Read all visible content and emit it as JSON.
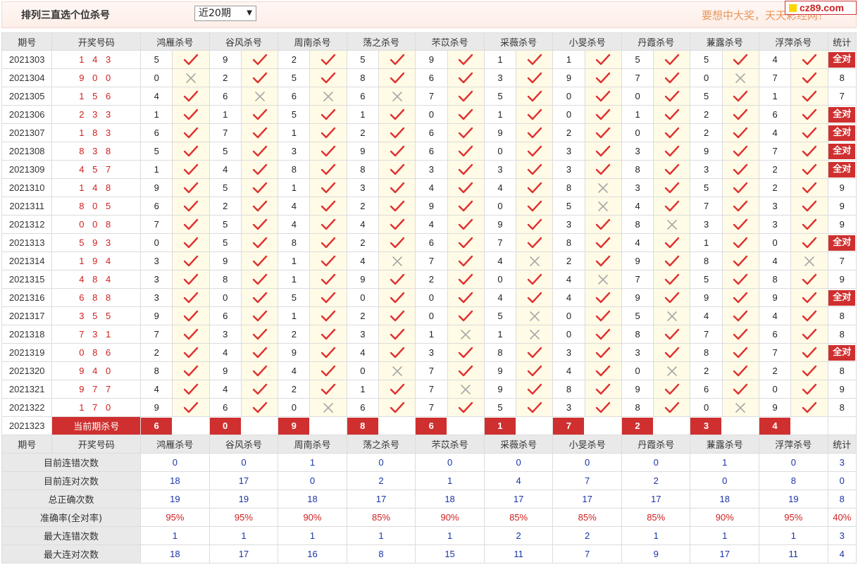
{
  "header": {
    "title": "排列三直选个位杀号",
    "period_select": "近20期",
    "slogan": "要想中大奖，天天彩经网！",
    "site": "cz89.com"
  },
  "columns": {
    "issue": "期号",
    "draw": "开奖号码",
    "experts": [
      "鸿雁杀号",
      "谷风杀号",
      "周南杀号",
      "荡之杀号",
      "芣苡杀号",
      "采薇杀号",
      "小旻杀号",
      "丹霞杀号",
      "蒹露杀号",
      "浮萍杀号"
    ],
    "stat": "统计"
  },
  "rows": [
    {
      "issue": "2021303",
      "draw": "1 4 3",
      "kills": [
        [
          5,
          1
        ],
        [
          9,
          1
        ],
        [
          2,
          1
        ],
        [
          5,
          1
        ],
        [
          9,
          1
        ],
        [
          1,
          1
        ],
        [
          1,
          1
        ],
        [
          5,
          1
        ],
        [
          5,
          1
        ],
        [
          4,
          1
        ]
      ],
      "stat": "全对"
    },
    {
      "issue": "2021304",
      "draw": "9 0 0",
      "kills": [
        [
          0,
          0
        ],
        [
          2,
          1
        ],
        [
          5,
          1
        ],
        [
          8,
          1
        ],
        [
          6,
          1
        ],
        [
          3,
          1
        ],
        [
          9,
          1
        ],
        [
          7,
          1
        ],
        [
          0,
          0
        ],
        [
          7,
          1
        ]
      ],
      "stat": "8"
    },
    {
      "issue": "2021305",
      "draw": "1 5 6",
      "kills": [
        [
          4,
          1
        ],
        [
          6,
          0
        ],
        [
          6,
          0
        ],
        [
          6,
          0
        ],
        [
          7,
          1
        ],
        [
          5,
          1
        ],
        [
          0,
          1
        ],
        [
          0,
          1
        ],
        [
          5,
          1
        ],
        [
          1,
          1
        ]
      ],
      "stat": "7"
    },
    {
      "issue": "2021306",
      "draw": "2 3 3",
      "kills": [
        [
          1,
          1
        ],
        [
          1,
          1
        ],
        [
          5,
          1
        ],
        [
          1,
          1
        ],
        [
          0,
          1
        ],
        [
          1,
          1
        ],
        [
          0,
          1
        ],
        [
          1,
          1
        ],
        [
          2,
          1
        ],
        [
          6,
          1
        ]
      ],
      "stat": "全对"
    },
    {
      "issue": "2021307",
      "draw": "1 8 3",
      "kills": [
        [
          6,
          1
        ],
        [
          7,
          1
        ],
        [
          1,
          1
        ],
        [
          2,
          1
        ],
        [
          6,
          1
        ],
        [
          9,
          1
        ],
        [
          2,
          1
        ],
        [
          0,
          1
        ],
        [
          2,
          1
        ],
        [
          4,
          1
        ]
      ],
      "stat": "全对"
    },
    {
      "issue": "2021308",
      "draw": "8 3 8",
      "kills": [
        [
          5,
          1
        ],
        [
          5,
          1
        ],
        [
          3,
          1
        ],
        [
          9,
          1
        ],
        [
          6,
          1
        ],
        [
          0,
          1
        ],
        [
          3,
          1
        ],
        [
          3,
          1
        ],
        [
          9,
          1
        ],
        [
          7,
          1
        ]
      ],
      "stat": "全对"
    },
    {
      "issue": "2021309",
      "draw": "4 5 7",
      "kills": [
        [
          1,
          1
        ],
        [
          4,
          1
        ],
        [
          8,
          1
        ],
        [
          8,
          1
        ],
        [
          3,
          1
        ],
        [
          3,
          1
        ],
        [
          3,
          1
        ],
        [
          8,
          1
        ],
        [
          3,
          1
        ],
        [
          2,
          1
        ]
      ],
      "stat": "全对"
    },
    {
      "issue": "2021310",
      "draw": "1 4 8",
      "kills": [
        [
          9,
          1
        ],
        [
          5,
          1
        ],
        [
          1,
          1
        ],
        [
          3,
          1
        ],
        [
          4,
          1
        ],
        [
          4,
          1
        ],
        [
          8,
          0
        ],
        [
          3,
          1
        ],
        [
          5,
          1
        ],
        [
          2,
          1
        ]
      ],
      "stat": "9"
    },
    {
      "issue": "2021311",
      "draw": "8 0 5",
      "kills": [
        [
          6,
          1
        ],
        [
          2,
          1
        ],
        [
          4,
          1
        ],
        [
          2,
          1
        ],
        [
          9,
          1
        ],
        [
          0,
          1
        ],
        [
          5,
          0
        ],
        [
          4,
          1
        ],
        [
          7,
          1
        ],
        [
          3,
          1
        ]
      ],
      "stat": "9"
    },
    {
      "issue": "2021312",
      "draw": "0 0 8",
      "kills": [
        [
          7,
          1
        ],
        [
          5,
          1
        ],
        [
          4,
          1
        ],
        [
          4,
          1
        ],
        [
          4,
          1
        ],
        [
          9,
          1
        ],
        [
          3,
          1
        ],
        [
          8,
          0
        ],
        [
          3,
          1
        ],
        [
          3,
          1
        ]
      ],
      "stat": "9"
    },
    {
      "issue": "2021313",
      "draw": "5 9 3",
      "kills": [
        [
          0,
          1
        ],
        [
          5,
          1
        ],
        [
          8,
          1
        ],
        [
          2,
          1
        ],
        [
          6,
          1
        ],
        [
          7,
          1
        ],
        [
          8,
          1
        ],
        [
          4,
          1
        ],
        [
          1,
          1
        ],
        [
          0,
          1
        ]
      ],
      "stat": "全对"
    },
    {
      "issue": "2021314",
      "draw": "1 9 4",
      "kills": [
        [
          3,
          1
        ],
        [
          9,
          1
        ],
        [
          1,
          1
        ],
        [
          4,
          0
        ],
        [
          7,
          1
        ],
        [
          4,
          0
        ],
        [
          2,
          1
        ],
        [
          9,
          1
        ],
        [
          8,
          1
        ],
        [
          4,
          0
        ]
      ],
      "stat": "7"
    },
    {
      "issue": "2021315",
      "draw": "4 8 4",
      "kills": [
        [
          3,
          1
        ],
        [
          8,
          1
        ],
        [
          1,
          1
        ],
        [
          9,
          1
        ],
        [
          2,
          1
        ],
        [
          0,
          1
        ],
        [
          4,
          0
        ],
        [
          7,
          1
        ],
        [
          5,
          1
        ],
        [
          8,
          1
        ]
      ],
      "stat": "9"
    },
    {
      "issue": "2021316",
      "draw": "6 8 8",
      "kills": [
        [
          3,
          1
        ],
        [
          0,
          1
        ],
        [
          5,
          1
        ],
        [
          0,
          1
        ],
        [
          0,
          1
        ],
        [
          4,
          1
        ],
        [
          4,
          1
        ],
        [
          9,
          1
        ],
        [
          9,
          1
        ],
        [
          9,
          1
        ]
      ],
      "stat": "全对"
    },
    {
      "issue": "2021317",
      "draw": "3 5 5",
      "kills": [
        [
          9,
          1
        ],
        [
          6,
          1
        ],
        [
          1,
          1
        ],
        [
          2,
          1
        ],
        [
          0,
          1
        ],
        [
          5,
          0
        ],
        [
          0,
          1
        ],
        [
          5,
          0
        ],
        [
          4,
          1
        ],
        [
          4,
          1
        ]
      ],
      "stat": "8"
    },
    {
      "issue": "2021318",
      "draw": "7 3 1",
      "kills": [
        [
          7,
          1
        ],
        [
          3,
          1
        ],
        [
          2,
          1
        ],
        [
          3,
          1
        ],
        [
          1,
          0
        ],
        [
          1,
          0
        ],
        [
          0,
          1
        ],
        [
          8,
          1
        ],
        [
          7,
          1
        ],
        [
          6,
          1
        ]
      ],
      "stat": "8"
    },
    {
      "issue": "2021319",
      "draw": "0 8 6",
      "kills": [
        [
          2,
          1
        ],
        [
          4,
          1
        ],
        [
          9,
          1
        ],
        [
          4,
          1
        ],
        [
          3,
          1
        ],
        [
          8,
          1
        ],
        [
          3,
          1
        ],
        [
          3,
          1
        ],
        [
          8,
          1
        ],
        [
          7,
          1
        ]
      ],
      "stat": "全对"
    },
    {
      "issue": "2021320",
      "draw": "9 4 0",
      "kills": [
        [
          8,
          1
        ],
        [
          9,
          1
        ],
        [
          4,
          1
        ],
        [
          0,
          0
        ],
        [
          7,
          1
        ],
        [
          9,
          1
        ],
        [
          4,
          1
        ],
        [
          0,
          0
        ],
        [
          2,
          1
        ],
        [
          2,
          1
        ]
      ],
      "stat": "8"
    },
    {
      "issue": "2021321",
      "draw": "9 7 7",
      "kills": [
        [
          4,
          1
        ],
        [
          4,
          1
        ],
        [
          2,
          1
        ],
        [
          1,
          1
        ],
        [
          7,
          0
        ],
        [
          9,
          1
        ],
        [
          8,
          1
        ],
        [
          9,
          1
        ],
        [
          6,
          1
        ],
        [
          0,
          1
        ]
      ],
      "stat": "9"
    },
    {
      "issue": "2021322",
      "draw": "1 7 0",
      "kills": [
        [
          9,
          1
        ],
        [
          6,
          1
        ],
        [
          0,
          0
        ],
        [
          6,
          1
        ],
        [
          7,
          1
        ],
        [
          5,
          1
        ],
        [
          3,
          1
        ],
        [
          8,
          1
        ],
        [
          0,
          0
        ],
        [
          9,
          1
        ]
      ],
      "stat": "8"
    }
  ],
  "current": {
    "issue": "2021323",
    "label": "当前期杀号",
    "kills": [
      "6",
      "0",
      "9",
      "8",
      "6",
      "1",
      "7",
      "2",
      "3",
      "4"
    ]
  },
  "summary": [
    {
      "label": "目前连错次数",
      "values": [
        "0",
        "0",
        "1",
        "0",
        "0",
        "0",
        "0",
        "0",
        "1",
        "0"
      ],
      "stat": "3",
      "type": "num"
    },
    {
      "label": "目前连对次数",
      "values": [
        "18",
        "17",
        "0",
        "2",
        "1",
        "4",
        "7",
        "2",
        "0",
        "8"
      ],
      "stat": "0",
      "type": "num"
    },
    {
      "label": "总正确次数",
      "values": [
        "19",
        "19",
        "18",
        "17",
        "18",
        "17",
        "17",
        "17",
        "18",
        "19"
      ],
      "stat": "8",
      "type": "num"
    },
    {
      "label": "准确率(全对率)",
      "values": [
        "95%",
        "95%",
        "90%",
        "85%",
        "90%",
        "85%",
        "85%",
        "85%",
        "90%",
        "95%"
      ],
      "stat": "40%",
      "type": "rate"
    },
    {
      "label": "最大连错次数",
      "values": [
        "1",
        "1",
        "1",
        "1",
        "1",
        "2",
        "2",
        "1",
        "1",
        "1"
      ],
      "stat": "3",
      "type": "num"
    },
    {
      "label": "最大连对次数",
      "values": [
        "18",
        "17",
        "16",
        "8",
        "15",
        "11",
        "7",
        "9",
        "17",
        "11"
      ],
      "stat": "4",
      "type": "num"
    }
  ],
  "colors": {
    "accent": "#cf2f2f",
    "check": "#e03030",
    "cross": "#a8a8a8",
    "blue": "#1b33a8"
  }
}
